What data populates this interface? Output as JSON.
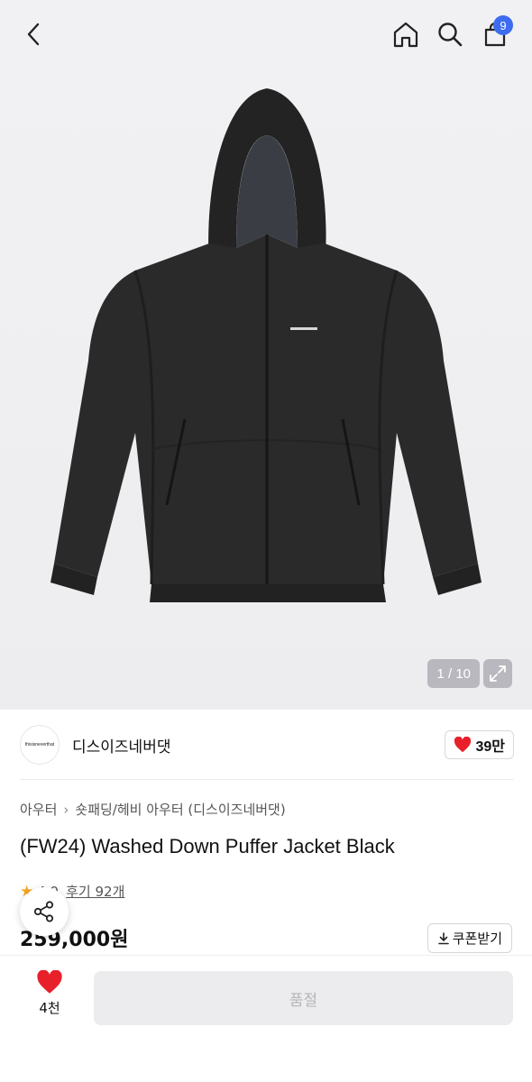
{
  "header": {
    "back_icon": "chevron-left-icon",
    "home_icon": "home-icon",
    "search_icon": "search-icon",
    "cart_icon": "shopping-bag-icon",
    "cart_count": "9",
    "badge_color": "#3d6cf0"
  },
  "gallery": {
    "counter": "1 / 10",
    "expand_icon": "expand-icon",
    "image_alt": "Black hooded puffer jacket"
  },
  "brand": {
    "logo_text": "thisisneverthat",
    "name": "디스이즈네버댓",
    "likes": "39만"
  },
  "breadcrumb": {
    "level1": "아우터",
    "level2": "숏패딩/헤비 아우터 (디스이즈네버댓)"
  },
  "product": {
    "title": "(FW24) Washed Down Puffer Jacket Black",
    "rating": "4.9",
    "reviews": "후기 92개",
    "price": "259,000원",
    "coupon_label": "쿠폰받기"
  },
  "bottom_bar": {
    "wish_count": "4천",
    "action_label": "품절",
    "heart_color": "#e8202a"
  }
}
